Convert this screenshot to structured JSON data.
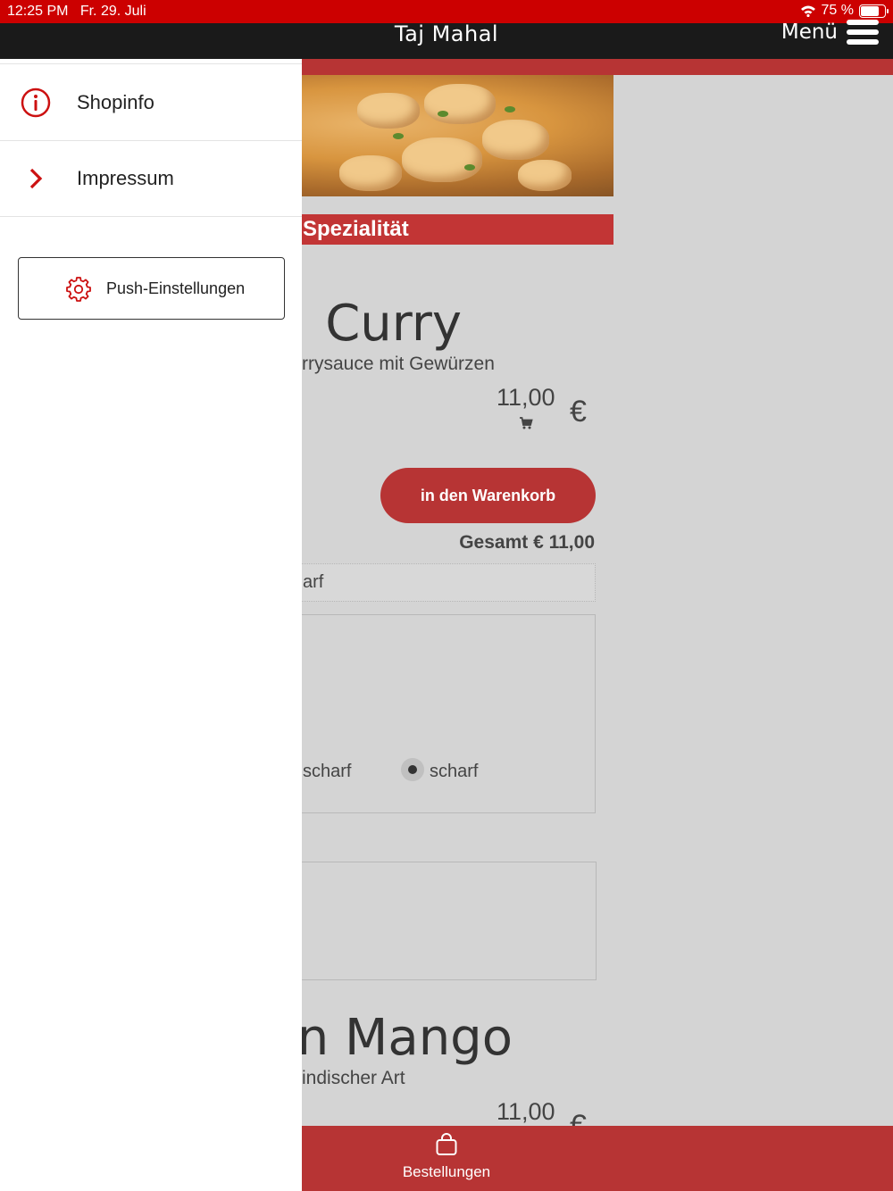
{
  "status_bar": {
    "time": "12:25 PM",
    "date": "Fr. 29. Juli",
    "battery": "75 %",
    "battery_level": 0.75
  },
  "header": {
    "title": "Taj Mahal",
    "menu_label": "Menü"
  },
  "category": {
    "label": "Spezialität"
  },
  "dish1": {
    "title": "Curry",
    "description": "rrysauce mit Gewürzen",
    "price": "11,00",
    "currency": "€",
    "add_to_cart": "in den Warenkorb",
    "total": "Gesamt € 11,00",
    "select_value": "arf",
    "options": [
      {
        "label": "scharf",
        "selected": false
      },
      {
        "label": "scharf",
        "selected": true
      }
    ]
  },
  "dish2": {
    "title": "n Mango",
    "description": "indischer Art",
    "price": "11,00",
    "currency": "€"
  },
  "bottom_nav": {
    "label": "Bestellungen"
  },
  "drawer": {
    "items": [
      {
        "label": "Shopinfo",
        "icon": "info-icon"
      },
      {
        "label": "Impressum",
        "icon": "chevron-right-icon"
      }
    ],
    "push_button": "Push-Einstellungen"
  },
  "colors": {
    "accent": "#b73434",
    "statusbar": "#cc0000",
    "drawer_icon": "#cc1111"
  }
}
